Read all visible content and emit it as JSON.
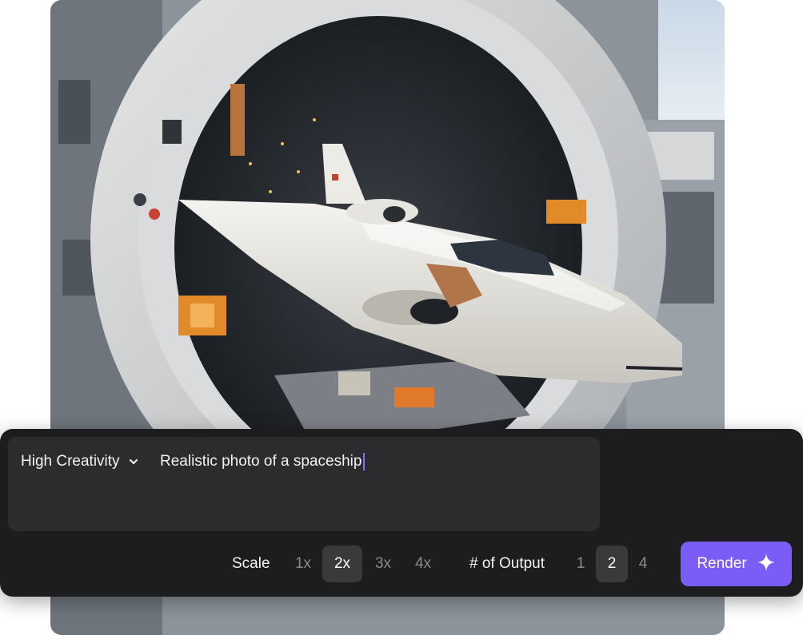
{
  "prompt": {
    "mode_label": "High Creativity",
    "text": "Realistic photo of a spaceship"
  },
  "scale": {
    "label": "Scale",
    "options": [
      "1x",
      "2x",
      "3x",
      "4x"
    ],
    "selected": "2x"
  },
  "outputs": {
    "label": "# of Output",
    "options": [
      "1",
      "2",
      "4"
    ],
    "selected": "2"
  },
  "render": {
    "label": "Render"
  },
  "colors": {
    "panel_bg": "#1d1d1f",
    "prompt_bg": "#2c2c2e",
    "accent": "#7b5cf6",
    "active_option_bg": "#3a3a3c"
  },
  "icons": {
    "mode_dropdown": "chevron-down-icon",
    "render": "sparkle-icon"
  }
}
